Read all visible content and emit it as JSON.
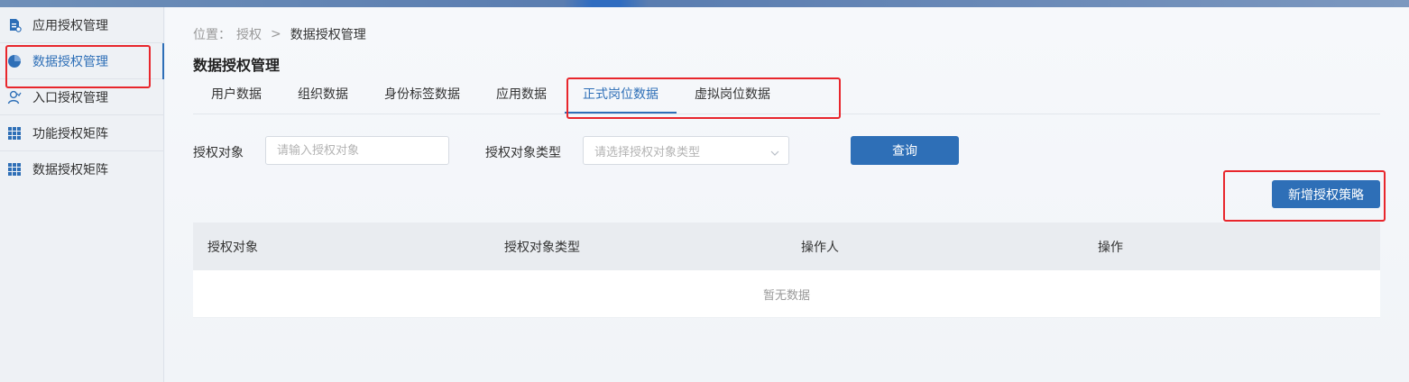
{
  "sidebar": {
    "items": [
      {
        "label": "应用授权管理",
        "icon": "app-doc-icon",
        "active": false
      },
      {
        "label": "数据授权管理",
        "icon": "pie-chart-icon",
        "active": true
      },
      {
        "label": "入口授权管理",
        "icon": "user-icon",
        "active": false
      },
      {
        "label": "功能授权矩阵",
        "icon": "grid-icon",
        "active": false
      },
      {
        "label": "数据授权矩阵",
        "icon": "grid-icon",
        "active": false
      }
    ]
  },
  "breadcrumb": {
    "prefix": "位置：",
    "level1": "授权",
    "separator": ">",
    "current": "数据授权管理"
  },
  "page": {
    "title": "数据授权管理"
  },
  "tabs": [
    {
      "label": "用户数据",
      "active": false
    },
    {
      "label": "组织数据",
      "active": false
    },
    {
      "label": "身份标签数据",
      "active": false
    },
    {
      "label": "应用数据",
      "active": false
    },
    {
      "label": "正式岗位数据",
      "active": true
    },
    {
      "label": "虚拟岗位数据",
      "active": false
    }
  ],
  "filters": {
    "target_label": "授权对象",
    "target_placeholder": "请输入授权对象",
    "type_label": "授权对象类型",
    "type_placeholder": "请选择授权对象类型",
    "query_button": "查询"
  },
  "actions": {
    "add_policy_button": "新增授权策略"
  },
  "table": {
    "columns": [
      "授权对象",
      "授权对象类型",
      "操作人",
      "操作"
    ],
    "empty_text": "暂无数据"
  },
  "colors": {
    "accent": "#2e6fb7",
    "highlight_box": "#e8262c"
  }
}
